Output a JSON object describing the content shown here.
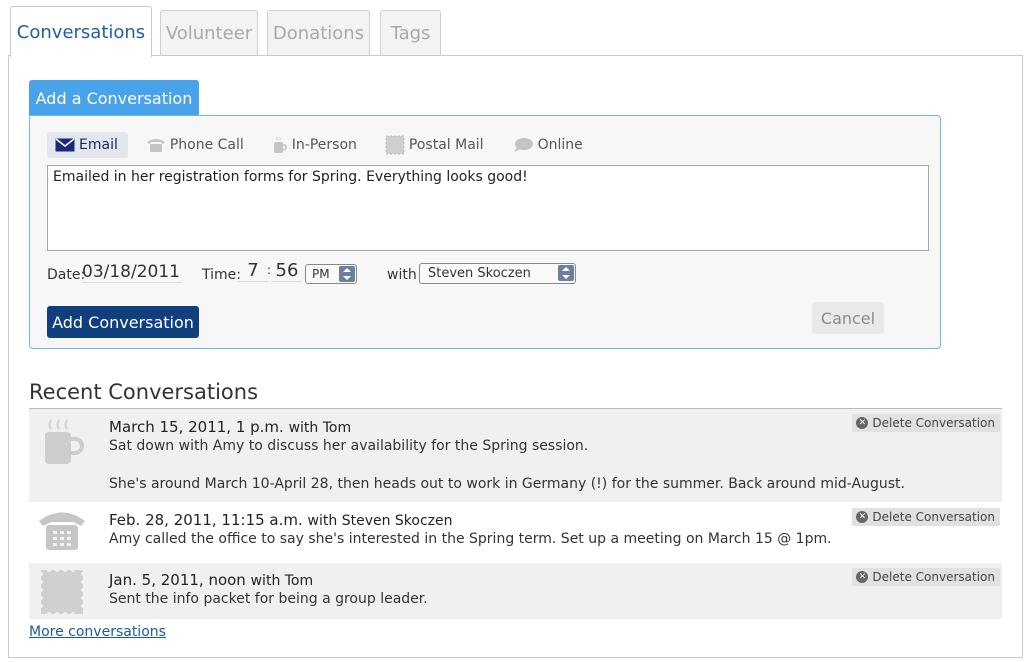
{
  "tabs": [
    "Conversations",
    "Volunteer",
    "Donations",
    "Tags"
  ],
  "add_section": {
    "title": "Add a Conversation",
    "types": [
      "Email",
      "Phone Call",
      "In-Person",
      "Postal Mail",
      "Online"
    ],
    "active_type": "Email",
    "note_value": "Emailed in her registration forms for Spring. Everything looks good!",
    "date_label": "Date:",
    "date_value": "03/18/2011",
    "time_label": "Time:",
    "hour": "7",
    "minute": "56",
    "time_sep": ":",
    "ampm": "PM",
    "with_label": "with",
    "with_value": "Steven Skoczen",
    "add_button": "Add Conversation",
    "cancel_button": "Cancel"
  },
  "recent": {
    "title": "Recent Conversations",
    "delete_label": "Delete Conversation",
    "items": [
      {
        "icon": "coffee-cup-icon",
        "date": "March 15, 2011, 1 p.m.",
        "with": "with Tom",
        "lines": [
          "Sat down with Amy to discuss her availability for the Spring session.",
          "She's around March 10-April 28, then heads out to work in Germany (!) for the summer. Back around mid-August."
        ]
      },
      {
        "icon": "telephone-icon",
        "date": "Feb. 28, 2011, 11:15 a.m.",
        "with": "with Steven Skoczen",
        "lines": [
          "Amy called the office to say she's interested in the Spring term. Set up a meeting on March 15 @ 1pm."
        ]
      },
      {
        "icon": "postage-stamp-icon",
        "date": "Jan. 5, 2011, noon",
        "with": "with Tom",
        "lines": [
          "Sent the info packet for being a group leader."
        ]
      }
    ],
    "more_link": "More conversations"
  },
  "colors": {
    "accent": "#49a3ea",
    "primary_button": "#0f3f7d",
    "active_tab_text": "#1f5f9f"
  }
}
